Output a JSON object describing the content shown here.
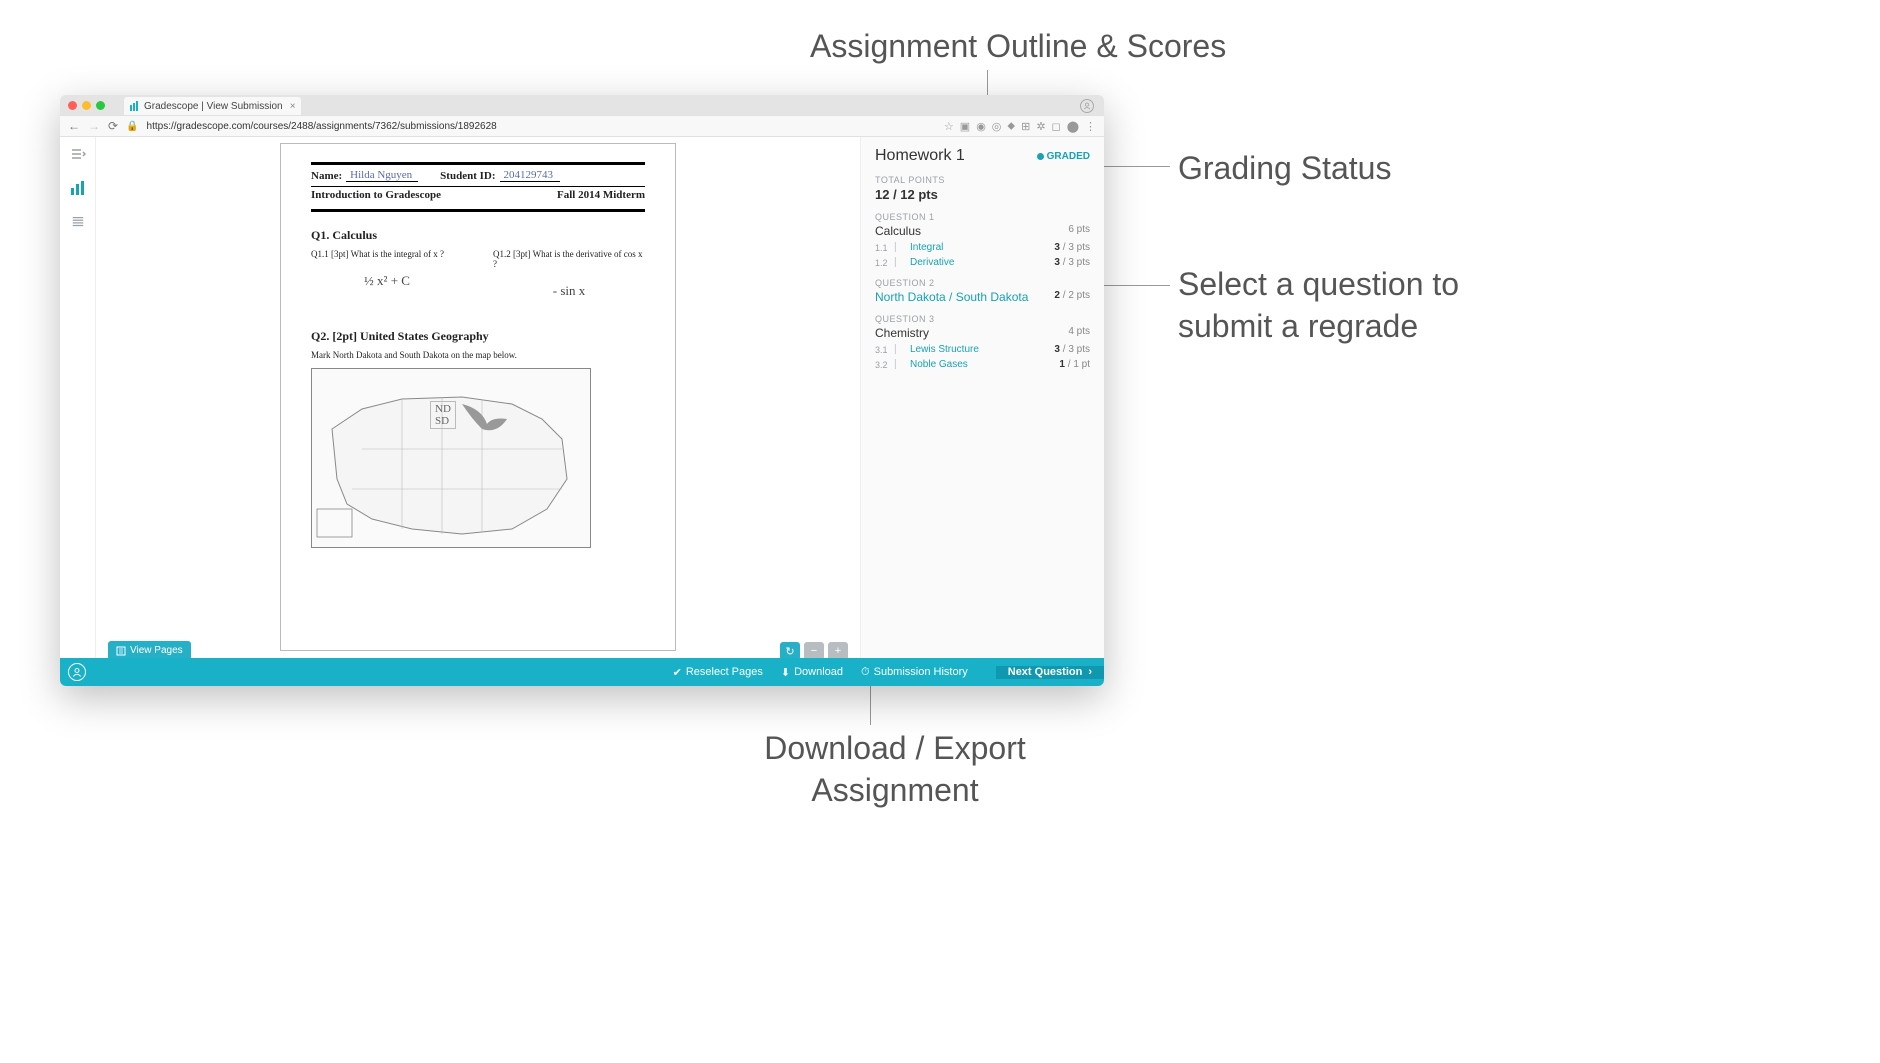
{
  "annotations": {
    "outline": "Assignment Outline & Scores",
    "status": "Grading Status",
    "regrade_l1": "Select a question to",
    "regrade_l2": "submit a regrade",
    "download_l1": "Download / Export",
    "download_l2": "Assignment"
  },
  "browser": {
    "tab_title": "Gradescope | View Submission",
    "url": "https://gradescope.com/courses/2488/assignments/7362/submissions/1892628"
  },
  "document": {
    "name_label": "Name:",
    "name_value": "Hilda Nguyen",
    "id_label": "Student ID:",
    "id_value": "204129743",
    "course": "Introduction to Gradescope",
    "term": "Fall 2014 Midterm",
    "q1_title": "Q1.  Calculus",
    "q1_1": "Q1.1  [3pt]  What is the integral of x ?",
    "q1_2": "Q1.2  [3pt]  What is the derivative of  cos x ?",
    "ans1": "½ x² + C",
    "ans2": "- sin x",
    "q2_title": "Q2.  [2pt] United States Geography",
    "q2_text": "Mark North Dakota and South Dakota on the map below.",
    "map_nd": "ND",
    "map_sd": "SD"
  },
  "controls": {
    "view_pages": "View Pages"
  },
  "outline": {
    "title": "Homework 1",
    "graded": "GRADED",
    "total_label": "TOTAL POINTS",
    "total_value": "12 / 12 pts",
    "q1_label": "QUESTION 1",
    "q1_name": "Calculus",
    "q1_pts": "6 pts",
    "q1_1_num": "1.1",
    "q1_1_name": "Integral",
    "q1_1_earn": "3",
    "q1_1_max": " / 3 pts",
    "q1_2_num": "1.2",
    "q1_2_name": "Derivative",
    "q1_2_earn": "3",
    "q1_2_max": " / 3 pts",
    "q2_label": "QUESTION 2",
    "q2_name": "North Dakota / South Dakota",
    "q2_earn": "2",
    "q2_max": " / 2 pts",
    "q3_label": "QUESTION 3",
    "q3_name": "Chemistry",
    "q3_pts": "4 pts",
    "q3_1_num": "3.1",
    "q3_1_name": "Lewis Structure",
    "q3_1_earn": "3",
    "q3_1_max": " / 3 pts",
    "q3_2_num": "3.2",
    "q3_2_name": "Noble Gases",
    "q3_2_earn": "1",
    "q3_2_max": " / 1 pt"
  },
  "footer": {
    "reselect": "Reselect Pages",
    "download": "Download",
    "history": "Submission History",
    "next": "Next Question"
  }
}
